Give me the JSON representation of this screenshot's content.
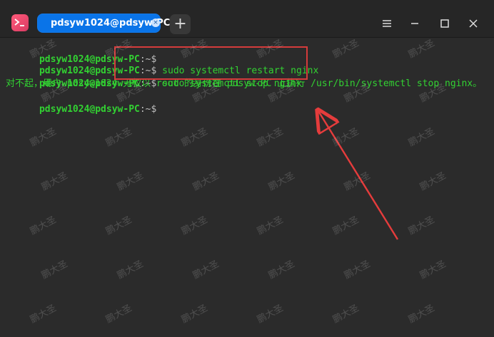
{
  "window": {
    "tab_title": "pdsyw1024@pdsyw-PC: ~",
    "new_tab_symbol": "+",
    "controls": [
      "menu",
      "minimize",
      "maximize",
      "close"
    ]
  },
  "terminal": {
    "lines": [
      {
        "prompt_user": "pdsyw1024@pdsyw-PC",
        "prompt_path": ":~$",
        "command": ""
      },
      {
        "prompt_user": "pdsyw1024@pdsyw-PC",
        "prompt_path": ":~$",
        "command": " sudo systemctl restart nginx"
      },
      {
        "prompt_user": "pdsyw1024@pdsyw-PC",
        "prompt_path": ":~$",
        "command": " sudo systemctl stop nginx"
      },
      {
        "message": "对不起，用户 pdsyw1024 无权以 root 的身份在 pdsyw-PC 上执行 /usr/bin/systemctl stop nginx。"
      },
      {
        "prompt_user": "pdsyw1024@pdsyw-PC",
        "prompt_path": ":~$",
        "command": ""
      }
    ]
  },
  "annotation": {
    "box_color": "#d53b3b",
    "arrow_color": "#e53c3c"
  },
  "watermark": {
    "text": "鹏大圣"
  }
}
